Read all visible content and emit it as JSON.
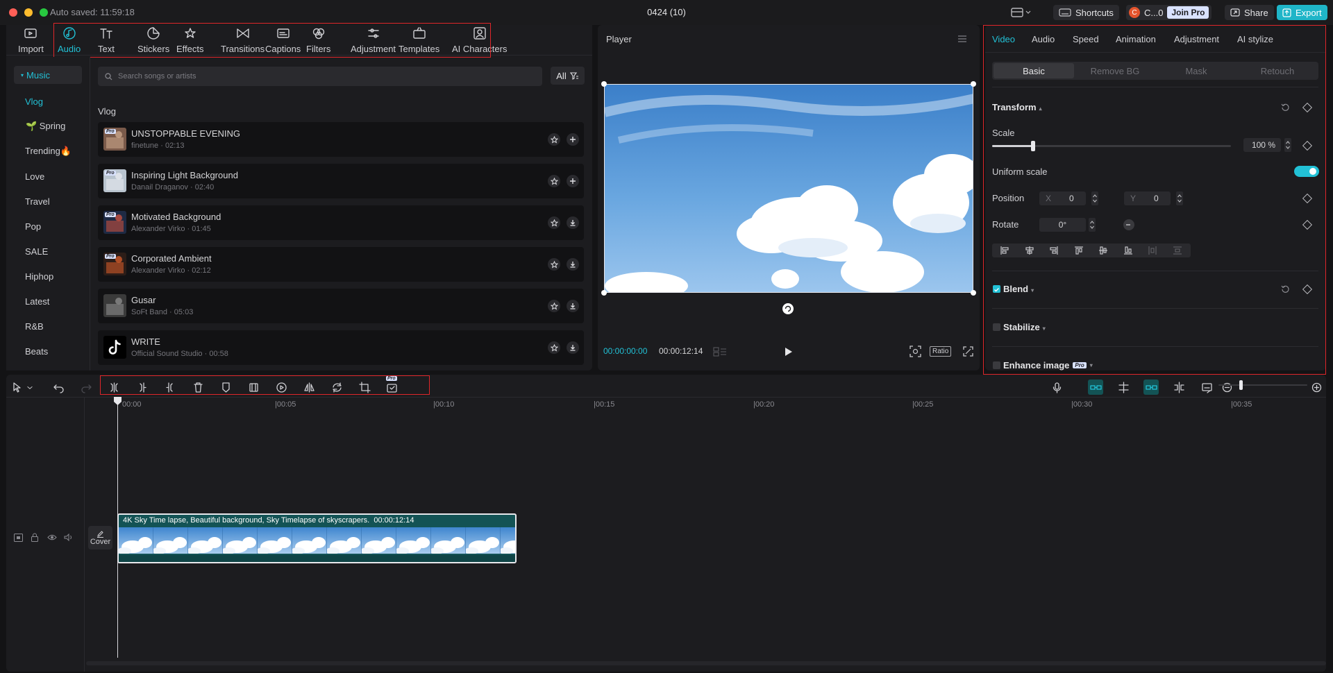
{
  "titlebar": {
    "autosave": "Auto saved: 11:59:18",
    "title": "0424 (10)",
    "shortcuts": "Shortcuts",
    "account": "C...0",
    "account_initial": "C",
    "join_pro": "Join Pro",
    "share": "Share",
    "export": "Export"
  },
  "media_toolbar": [
    {
      "label": "Import",
      "icon": "import-icon"
    },
    {
      "label": "Audio",
      "icon": "audio-icon",
      "active": true
    },
    {
      "label": "Text",
      "icon": "text-icon"
    },
    {
      "label": "Stickers",
      "icon": "sticker-icon"
    },
    {
      "label": "Effects",
      "icon": "effects-icon"
    },
    {
      "label": "Transitions",
      "icon": "transitions-icon"
    },
    {
      "label": "Captions",
      "icon": "captions-icon"
    },
    {
      "label": "Filters",
      "icon": "filters-icon"
    },
    {
      "label": "Adjustment",
      "icon": "adjustment-icon"
    },
    {
      "label": "Templates",
      "icon": "templates-icon"
    },
    {
      "label": "AI Characters",
      "icon": "ai-characters-icon"
    }
  ],
  "audio_categories": {
    "header": "Music",
    "items": [
      "Vlog",
      "🌱 Spring",
      "Trending🔥",
      "Love",
      "Travel",
      "Pop",
      "SALE",
      "Hiphop",
      "Latest",
      "R&B",
      "Beats"
    ],
    "selected": "Vlog"
  },
  "search": {
    "placeholder": "Search songs or artists"
  },
  "filter": {
    "label": "All"
  },
  "section_title": "Vlog",
  "songs": [
    {
      "title": "UNSTOPPABLE EVENING",
      "artist": "finetune",
      "duration": "02:13",
      "action": "add",
      "pro": true
    },
    {
      "title": "Inspiring Light Background",
      "artist": "Danail Draganov",
      "duration": "02:40",
      "action": "add",
      "pro": true
    },
    {
      "title": "Motivated Background",
      "artist": "Alexander Virko",
      "duration": "01:45",
      "action": "download",
      "pro": true
    },
    {
      "title": "Corporated Ambient",
      "artist": "Alexander Virko",
      "duration": "02:12",
      "action": "download",
      "pro": true
    },
    {
      "title": "Gusar",
      "artist": "SoFt Band",
      "duration": "05:03",
      "action": "download",
      "pro": false
    },
    {
      "title": "WRITE",
      "artist": "Official Sound Studio",
      "duration": "00:58",
      "action": "download",
      "pro": false
    }
  ],
  "pro_badge": "Pro",
  "song_meta_sep": "·",
  "player": {
    "title": "Player",
    "current_time": "00:00:00:00",
    "total_time": "00:00:12:14",
    "ratio": "Ratio"
  },
  "inspector": {
    "tabs": [
      "Video",
      "Audio",
      "Speed",
      "Animation",
      "Adjustment",
      "AI stylize"
    ],
    "active_tab": "Video",
    "subtabs": [
      "Basic",
      "Remove BG",
      "Mask",
      "Retouch"
    ],
    "active_subtab": "Basic",
    "transform": "Transform",
    "scale_label": "Scale",
    "scale_value": "100",
    "scale_unit": "%",
    "scale_level": 0.1,
    "uniform_scale": "Uniform scale",
    "uniform_scale_on": true,
    "position_label": "Position",
    "x_label": "X",
    "x_value": "0",
    "y_label": "Y",
    "y_value": "0",
    "rotate_label": "Rotate",
    "rotate_value": "0°",
    "blend": "Blend",
    "blend_checked": true,
    "stabilize": "Stabilize",
    "enhance": "Enhance image",
    "accent": "#22c1d6"
  },
  "timeline": {
    "ruler": [
      "00:00",
      "|00:05",
      "|00:10",
      "|00:15",
      "|00:20",
      "|00:25",
      "|00:30",
      "|00:35"
    ],
    "clip_title": "4K Sky Time lapse, Beautiful background, Sky Timelapse of skyscrapers.",
    "clip_duration": "00:00:12:14",
    "cover": "Cover",
    "pro_badge": "Pro"
  }
}
